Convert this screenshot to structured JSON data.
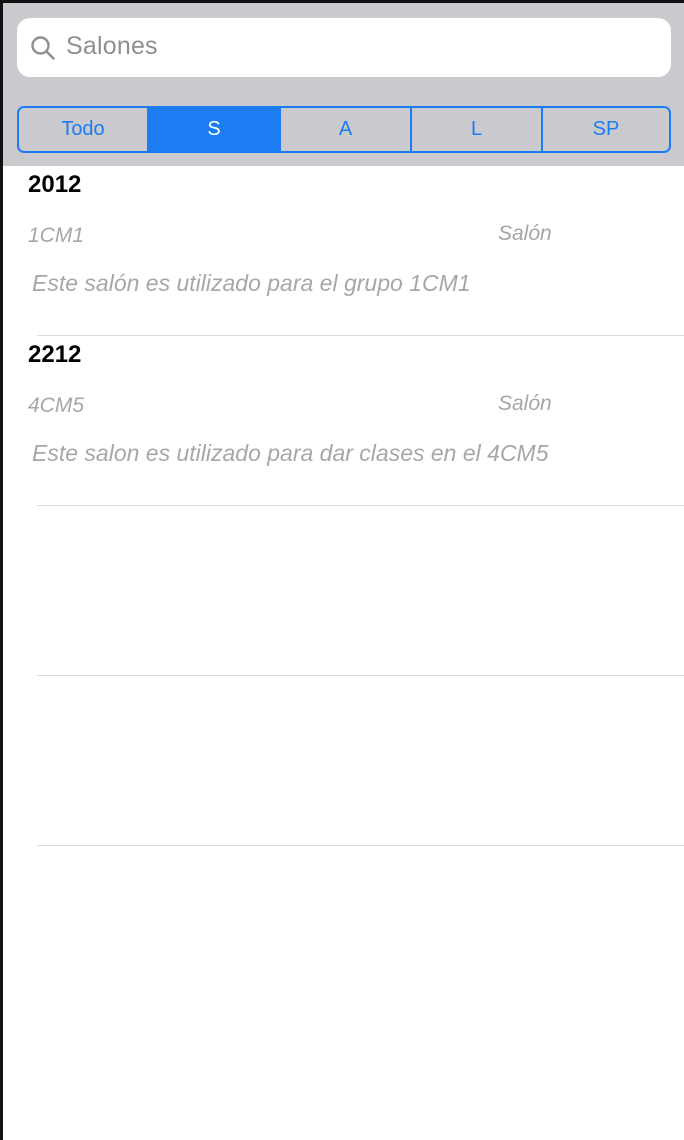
{
  "search": {
    "placeholder": "Salones",
    "icon": "search-icon"
  },
  "segments": [
    {
      "label": "Todo",
      "selected": false
    },
    {
      "label": "S",
      "selected": true
    },
    {
      "label": "A",
      "selected": false
    },
    {
      "label": "L",
      "selected": false
    },
    {
      "label": "SP",
      "selected": false
    }
  ],
  "rows": [
    {
      "title": "2012",
      "code": "1CM1",
      "type": "Salón",
      "description": "Este salón es utilizado para el grupo 1CM1"
    },
    {
      "title": "2212",
      "code": "4CM5",
      "type": "Salón",
      "description": "Este salon es utilizado para dar clases en el 4CM5"
    }
  ],
  "colors": {
    "accent": "#1b7cf3",
    "bar_background": "#c9c9ce",
    "secondary_text": "#a6a6ab"
  }
}
